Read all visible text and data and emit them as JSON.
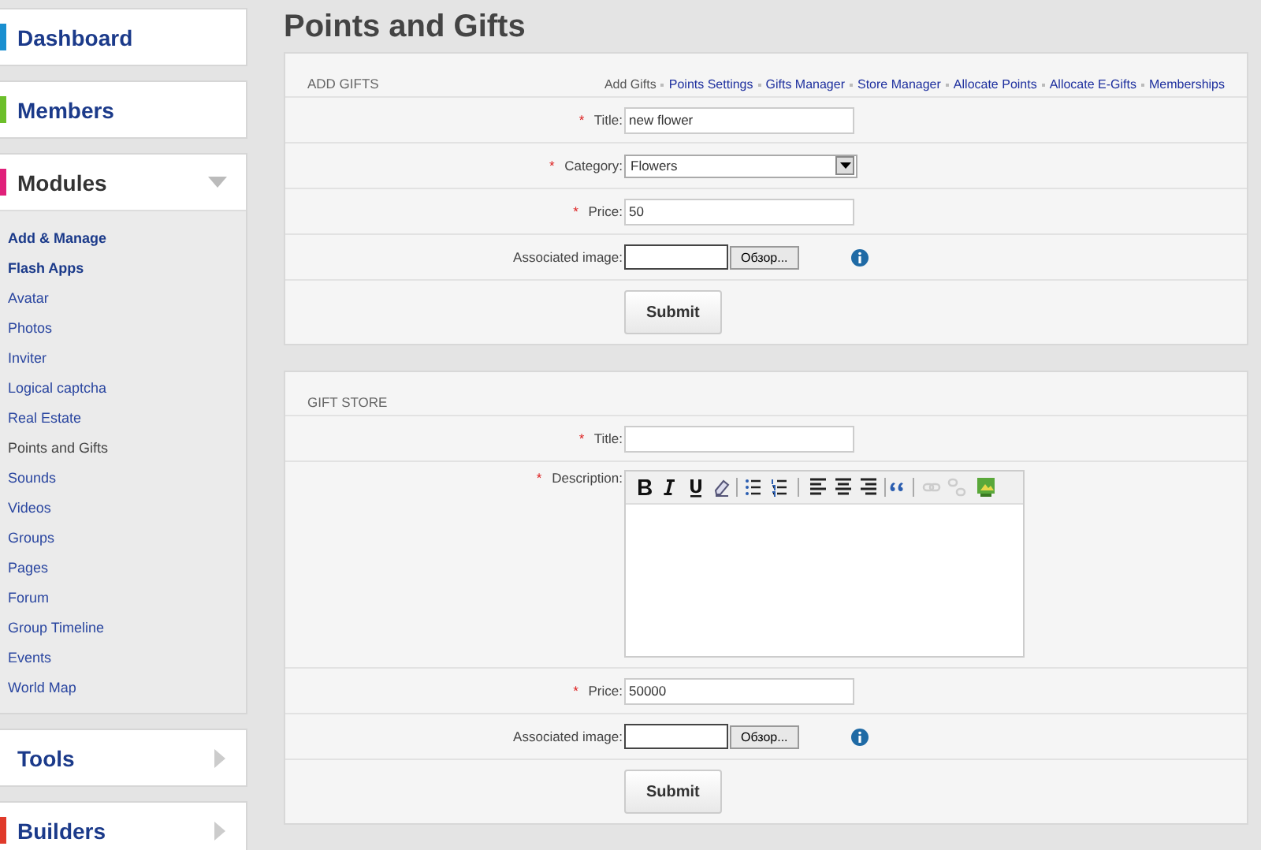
{
  "sidebar": [
    {
      "label": "Dashboard",
      "kind": "link",
      "color": "#1a8fd0"
    },
    {
      "label": "Members",
      "kind": "link",
      "color": "#6cbf2a"
    },
    {
      "label": "Modules",
      "kind": "group",
      "color": "#e0207a",
      "expanded": true,
      "children": [
        {
          "label": "Add & Manage",
          "bold": true,
          "selected": false
        },
        {
          "label": "Flash Apps",
          "bold": true,
          "selected": false
        },
        {
          "label": "Avatar",
          "bold": false,
          "selected": false
        },
        {
          "label": "Photos",
          "bold": false,
          "selected": false
        },
        {
          "label": "Inviter",
          "bold": false,
          "selected": false
        },
        {
          "label": "Logical captcha",
          "bold": false,
          "selected": false
        },
        {
          "label": "Real Estate",
          "bold": false,
          "selected": false
        },
        {
          "label": "Points and Gifts",
          "bold": false,
          "selected": true
        },
        {
          "label": "Sounds",
          "bold": false,
          "selected": false
        },
        {
          "label": "Videos",
          "bold": false,
          "selected": false
        },
        {
          "label": "Groups",
          "bold": false,
          "selected": false
        },
        {
          "label": "Pages",
          "bold": false,
          "selected": false
        },
        {
          "label": "Forum",
          "bold": false,
          "selected": false
        },
        {
          "label": "Group Timeline",
          "bold": false,
          "selected": false
        },
        {
          "label": "Events",
          "bold": false,
          "selected": false
        },
        {
          "label": "World Map",
          "bold": false,
          "selected": false
        }
      ]
    },
    {
      "label": "Tools",
      "kind": "group",
      "expanded": false
    },
    {
      "label": "Builders",
      "kind": "group",
      "color": "#e03a2a",
      "expanded": false
    }
  ],
  "page_title": "Points and Gifts",
  "panels": [
    {
      "heading": "ADD GIFTS",
      "menu": [
        {
          "label": "Add Gifts",
          "selected": true
        },
        {
          "label": "Points Settings",
          "selected": false
        },
        {
          "label": "Gifts Manager",
          "selected": false
        },
        {
          "label": "Store Manager",
          "selected": false
        },
        {
          "label": "Allocate Points",
          "selected": false
        },
        {
          "label": "Allocate E-Gifts",
          "selected": false
        },
        {
          "label": "Memberships",
          "selected": false
        }
      ],
      "fields": [
        {
          "kind": "text",
          "label": "Title:",
          "marker": "*",
          "value": "new flower"
        },
        {
          "kind": "select",
          "label": "Category:",
          "marker": "*",
          "value": "Flowers"
        },
        {
          "kind": "text",
          "label": "Price:",
          "marker": "*",
          "value": "50"
        },
        {
          "kind": "file",
          "label": "Associated image:",
          "button": "Обзор..."
        }
      ],
      "submit": "Submit"
    },
    {
      "heading": "GIFT STORE",
      "fields": [
        {
          "kind": "text",
          "label": "Title:",
          "marker": "*"
        },
        {
          "kind": "editor",
          "label": "Description:",
          "marker": "*"
        },
        {
          "kind": "text",
          "label": "Price:",
          "marker": "*",
          "value": "50000"
        },
        {
          "kind": "file",
          "label": "Associated image:",
          "button": "Обзор..."
        }
      ],
      "submit": "Submit"
    }
  ]
}
